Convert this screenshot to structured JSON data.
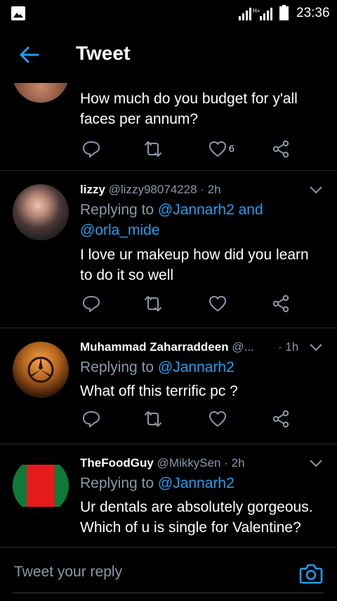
{
  "status_bar": {
    "time": "23:36",
    "network": "H+"
  },
  "header": {
    "title": "Tweet"
  },
  "tweets": [
    {
      "text_lines": [
        "How much do you budget for y'all",
        "faces per annum?"
      ],
      "like_count": "6"
    },
    {
      "name": "lizzy",
      "handle": "@lizzy98074228",
      "time": "· 2h",
      "replying_prefix": "Replying to ",
      "replying_mention_1": "@Jannarh2",
      "replying_and": " and",
      "replying_mention_2": "@orla_mide",
      "text_lines": [
        "I love ur makeup how did you learn",
        "to do it so well"
      ]
    },
    {
      "name": "Muhammad Zaharraddeen",
      "handle": "@...",
      "time": "· 1h",
      "replying_prefix": "Replying to ",
      "replying_mention_1": "@Jannarh2",
      "text_lines": [
        "What off this terrific pc ?"
      ]
    },
    {
      "name": "TheFoodGuy",
      "handle": "@MikkySen",
      "time": "· 2h",
      "replying_prefix": "Replying to ",
      "replying_mention_1": "@Jannarh2",
      "text_lines": [
        "Ur dentals are absolutely gorgeous.",
        "Which of u is single for Valentine?"
      ]
    }
  ],
  "reply_bar": {
    "placeholder": "Tweet your reply"
  },
  "colors": {
    "accent": "#1da1f2",
    "muted": "#8899a6",
    "background": "#000000"
  }
}
